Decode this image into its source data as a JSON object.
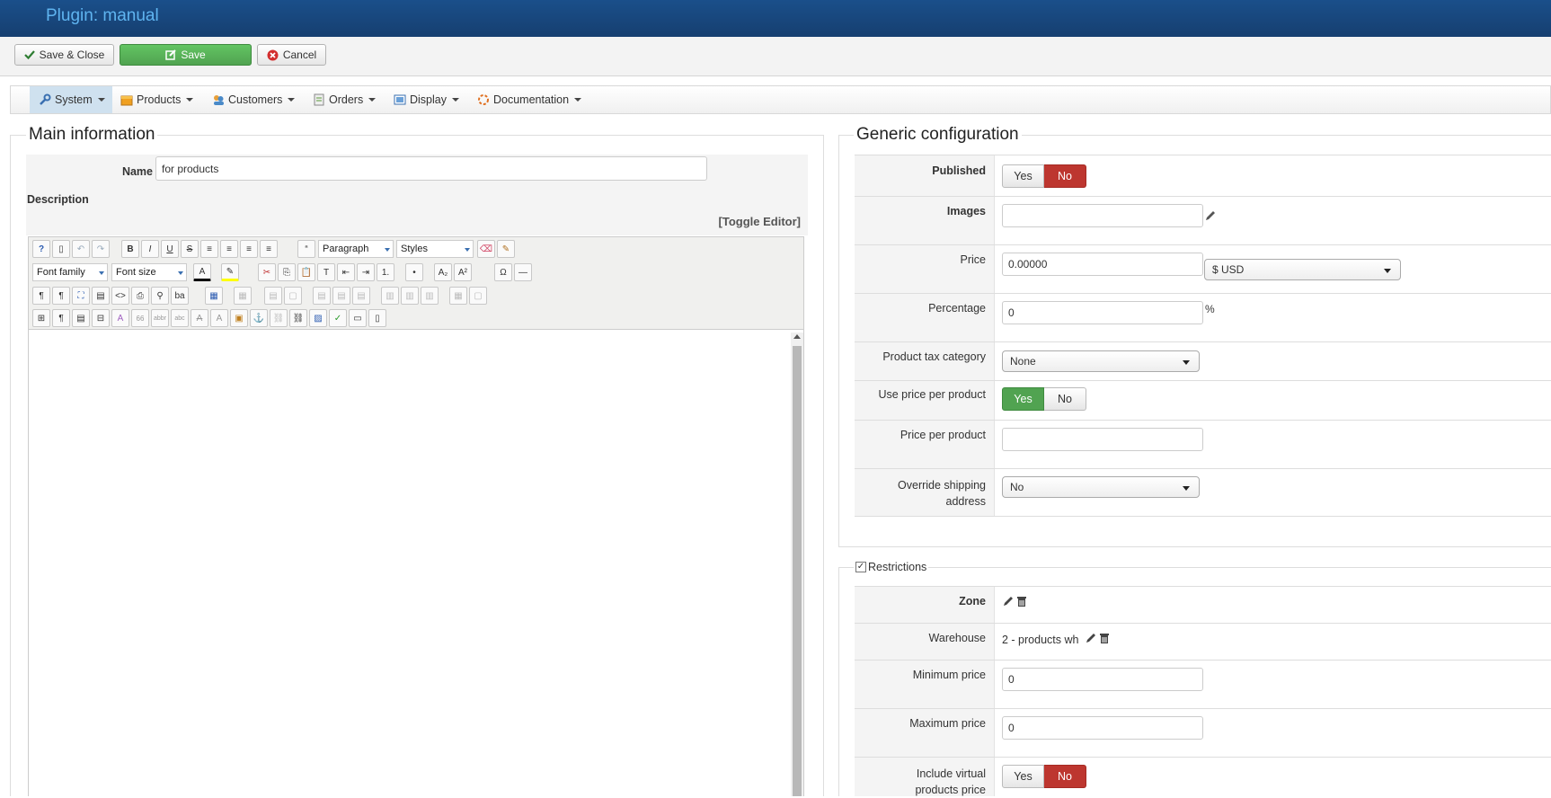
{
  "header": {
    "title": "Plugin: manual"
  },
  "toolbar": {
    "save_close": "Save & Close",
    "save": "Save",
    "cancel": "Cancel"
  },
  "menu": {
    "items": [
      {
        "label": "System",
        "icon": "wrench-icon"
      },
      {
        "label": "Products",
        "icon": "box-icon"
      },
      {
        "label": "Customers",
        "icon": "users-icon"
      },
      {
        "label": "Orders",
        "icon": "orders-icon"
      },
      {
        "label": "Display",
        "icon": "display-icon"
      },
      {
        "label": "Documentation",
        "icon": "documentation-icon"
      }
    ]
  },
  "main": {
    "legend": "Main information",
    "name_label": "Name",
    "name_value": "for products",
    "description_label": "Description",
    "toggle_editor": "[Toggle Editor]",
    "editor": {
      "paragraph": "Paragraph",
      "styles": "Styles",
      "font_family": "Font family",
      "font_size": "Font size"
    }
  },
  "generic": {
    "legend": "Generic configuration",
    "published_label": "Published",
    "images_label": "Images",
    "price_label": "Price",
    "price_value": "0.00000",
    "currency": "$ USD",
    "percentage_label": "Percentage",
    "percentage_value": "0",
    "percent_sign": "%",
    "tax_label": "Product tax category",
    "tax_value": "None",
    "use_price_label": "Use price per product",
    "price_per_product_label": "Price per product",
    "override_shipping_label_1": "Override shipping",
    "override_shipping_label_2": "address",
    "override_shipping_value": "No",
    "yes": "Yes",
    "no": "No"
  },
  "restrictions": {
    "legend": "Restrictions",
    "zone_label": "Zone",
    "warehouse_label": "Warehouse",
    "warehouse_value": "2 - products wh",
    "min_price_label": "Minimum price",
    "min_price_value": "0",
    "max_price_label": "Maximum price",
    "max_price_value": "0",
    "include_virtual_label_1": "Include virtual",
    "include_virtual_label_2": "products price"
  },
  "colors": {
    "header": "#1a4f8a",
    "title": "#5fb4f0",
    "green": "#51a351",
    "red": "#bd362f"
  }
}
